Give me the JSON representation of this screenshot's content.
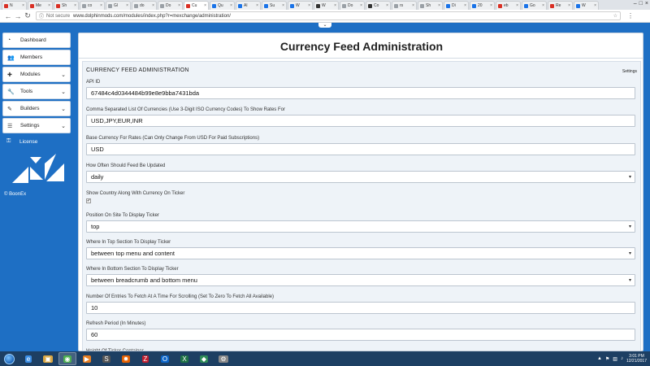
{
  "browser": {
    "tabs": [
      {
        "label": "N",
        "color": "#d93025"
      },
      {
        "label": "Me",
        "color": "#d93025"
      },
      {
        "label": "Sh",
        "color": "#d93025"
      },
      {
        "label": "co",
        "color": "#9aa0a6"
      },
      {
        "label": "Gl",
        "color": "#9aa0a6"
      },
      {
        "label": "do",
        "color": "#9aa0a6"
      },
      {
        "label": "Do",
        "color": "#9aa0a6"
      },
      {
        "label": "Cu",
        "color": "#d93025",
        "active": true
      },
      {
        "label": "Qu",
        "color": "#1a73e8"
      },
      {
        "label": "Al",
        "color": "#1a73e8"
      },
      {
        "label": "Su",
        "color": "#1a73e8"
      },
      {
        "label": "W",
        "color": "#1a73e8"
      },
      {
        "label": "W",
        "color": "#333333"
      },
      {
        "label": "Do",
        "color": "#9aa0a6"
      },
      {
        "label": "Co",
        "color": "#333333"
      },
      {
        "label": "rs",
        "color": "#9aa0a6"
      },
      {
        "label": "Sh",
        "color": "#9aa0a6"
      },
      {
        "label": "Di",
        "color": "#1a73e8"
      },
      {
        "label": "20",
        "color": "#1a73e8"
      },
      {
        "label": "eb",
        "color": "#d93025"
      },
      {
        "label": "Go",
        "color": "#1a73e8"
      },
      {
        "label": "Re",
        "color": "#d93025"
      },
      {
        "label": "W",
        "color": "#1a73e8"
      }
    ],
    "not_secure": "Not secure",
    "url": "www.dolphinmods.com/modules/index.php?r=mexchange/administration/"
  },
  "sidebar": {
    "items": [
      {
        "label": "Dashboard",
        "icon": "dashboard-icon",
        "glyph": "◔",
        "chevron": false
      },
      {
        "label": "Members",
        "icon": "users-icon",
        "glyph": "👥",
        "chevron": false
      },
      {
        "label": "Modules",
        "icon": "puzzle-icon",
        "glyph": "✚",
        "chevron": true
      },
      {
        "label": "Tools",
        "icon": "wrench-icon",
        "glyph": "🔧",
        "chevron": true
      },
      {
        "label": "Builders",
        "icon": "magic-icon",
        "glyph": "✎",
        "chevron": true
      },
      {
        "label": "Settings",
        "icon": "sliders-icon",
        "glyph": "☰",
        "chevron": true
      }
    ],
    "license": {
      "label": "License",
      "icon": "key-icon",
      "glyph": "⚿"
    },
    "copyright": "© BoonEx"
  },
  "main": {
    "title": "Currency Feed Administration",
    "panel_title": "CURRENCY FEED ADMINISTRATION",
    "settings_link": "Settings",
    "fields": [
      {
        "label": "API ID",
        "value": "67484c4d0344484b99e8e9bba7431bda",
        "type": "text"
      },
      {
        "label": "Comma Separated List Of Currencies (Use 3-Digit ISO Currency Codes) To Show Rates For",
        "value": "USD,JPY,EUR,INR",
        "type": "text"
      },
      {
        "label": "Base Currency For Rates (Can Only Change From USD For Paid Subscriptions)",
        "value": "USD",
        "type": "text"
      },
      {
        "label": "How Often Should Feed Be Updated",
        "value": "daily",
        "type": "select"
      },
      {
        "label": "Show Country Along With Currency On Ticker",
        "value": "✔",
        "type": "checkbox"
      },
      {
        "label": "Position On Site To Display Ticker",
        "value": "top",
        "type": "select"
      },
      {
        "label": "Where In Top Section To Display Ticker",
        "value": "between top menu and content",
        "type": "select"
      },
      {
        "label": "Where In Bottom Section To Display Ticker",
        "value": "between breadcrumb and bottom menu",
        "type": "select"
      },
      {
        "label": "Number Of Entries To Fetch At A Time For Scrolling (Set To Zero To Fetch All Available)",
        "value": "10",
        "type": "text"
      },
      {
        "label": "Refresh Period (In Minutes)",
        "value": "60",
        "type": "text"
      },
      {
        "label": "Height Of Ticker Container",
        "value": "",
        "type": "text"
      }
    ]
  },
  "taskbar": {
    "apps": [
      "ie-icon",
      "folder-icon",
      "chrome-icon",
      "media-icon",
      "sublime-icon",
      "firefox-icon",
      "filezilla-icon",
      "outlook-icon",
      "excel-icon",
      "game-icon",
      "tool-icon"
    ],
    "time": "3:01 PM",
    "date": "12/21/2017"
  }
}
